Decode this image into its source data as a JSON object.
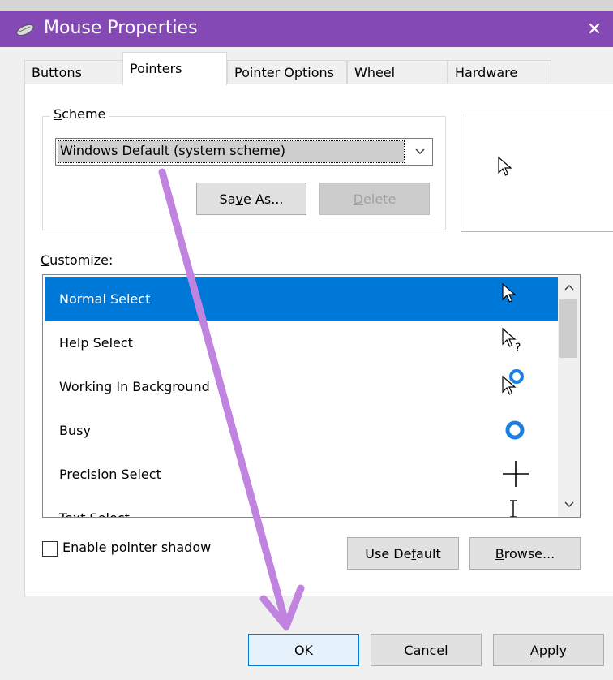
{
  "window": {
    "title": "Mouse Properties",
    "close_glyph": "✕"
  },
  "tabs": [
    {
      "label": "Buttons",
      "active": false
    },
    {
      "label": "Pointers",
      "active": true
    },
    {
      "label": "Pointer Options",
      "active": false
    },
    {
      "label": "Wheel",
      "active": false
    },
    {
      "label": "Hardware",
      "active": false
    }
  ],
  "scheme": {
    "group_label_mnemonic": "S",
    "group_label_rest": "cheme",
    "selected_value": "Windows Default (system scheme)",
    "save_as_pre": "Sa",
    "save_as_mnemonic": "v",
    "save_as_post": "e As...",
    "delete_mnemonic": "D",
    "delete_rest": "elete"
  },
  "customize": {
    "label_mnemonic": "C",
    "label_rest": "ustomize:",
    "rows": [
      {
        "label": "Normal Select",
        "icon": "arrow-pointer-icon",
        "selected": true
      },
      {
        "label": "Help Select",
        "icon": "help-pointer-icon",
        "selected": false
      },
      {
        "label": "Working In Background",
        "icon": "busy-arrow-pointer-icon",
        "selected": false
      },
      {
        "label": "Busy",
        "icon": "busy-ring-icon",
        "selected": false
      },
      {
        "label": "Precision Select",
        "icon": "crosshair-icon",
        "selected": false
      },
      {
        "label": "Text Select",
        "icon": "ibeam-icon",
        "selected": false
      }
    ]
  },
  "shadow": {
    "mnemonic": "E",
    "label_rest": "nable pointer shadow",
    "checked": false
  },
  "buttons": {
    "use_default_pre": "Use De",
    "use_default_mnemonic": "f",
    "use_default_post": "ault",
    "browse_mnemonic": "B",
    "browse_rest": "rowse...",
    "ok": "OK",
    "cancel": "Cancel",
    "apply_mnemonic": "A",
    "apply_rest": "pply"
  },
  "colors": {
    "titlebar": "#8549b6",
    "selection": "#0078d7",
    "annotation_arrow": "#c084e0",
    "busy_ring": "#1a7fe0"
  }
}
